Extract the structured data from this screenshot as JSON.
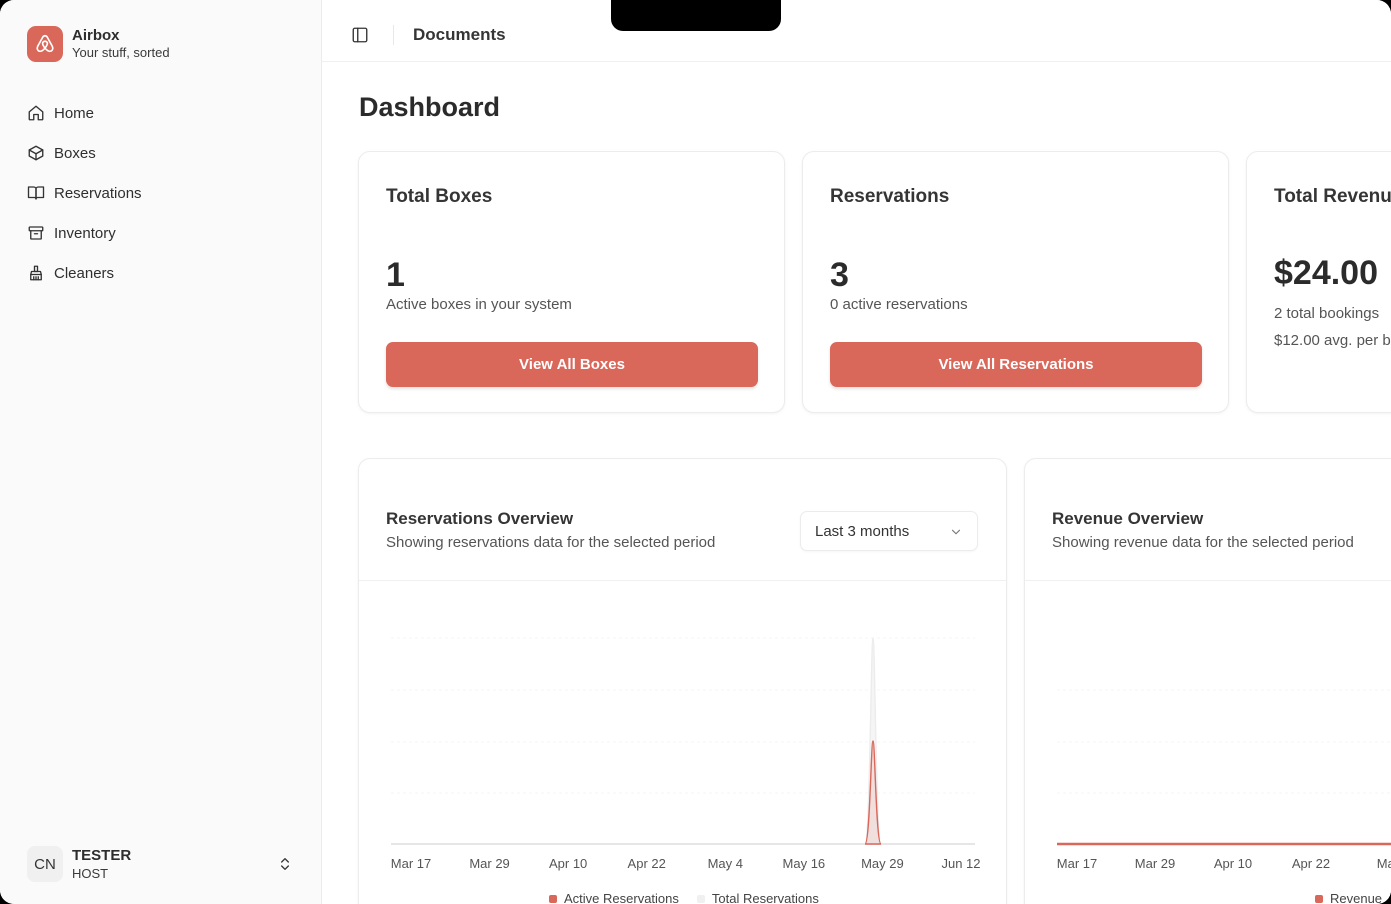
{
  "brand": {
    "name": "Airbox",
    "tagline": "Your stuff, sorted"
  },
  "sidebar": {
    "items": [
      {
        "label": "Home",
        "icon": "home-icon"
      },
      {
        "label": "Boxes",
        "icon": "box-icon"
      },
      {
        "label": "Reservations",
        "icon": "book-icon"
      },
      {
        "label": "Inventory",
        "icon": "archive-icon"
      },
      {
        "label": "Cleaners",
        "icon": "broom-icon"
      }
    ]
  },
  "user": {
    "initials": "CN",
    "name": "TESTER",
    "role": "HOST"
  },
  "header": {
    "title": "Documents"
  },
  "page": {
    "title": "Dashboard"
  },
  "cards": {
    "boxes": {
      "title": "Total Boxes",
      "value": "1",
      "subtitle": "Active boxes in your system",
      "button": "View All Boxes"
    },
    "reservations": {
      "title": "Reservations",
      "value": "3",
      "subtitle": "0 active reservations",
      "button": "View All Reservations"
    },
    "revenue": {
      "title": "Total Revenu",
      "value": "$24.00",
      "line1": "2 total bookings",
      "line2": "$12.00 avg. per b"
    }
  },
  "reservations_overview": {
    "title": "Reservations Overview",
    "subtitle": "Showing reservations data for the selected period",
    "range_select": "Last 3 months"
  },
  "revenue_overview": {
    "title": "Revenue Overview",
    "subtitle": "Showing revenue data for the selected period"
  },
  "colors": {
    "accent": "#d9675a",
    "total_series": "#ececec"
  },
  "chart_data": [
    {
      "type": "area",
      "title": "Reservations Overview",
      "x": [
        "Mar 17",
        "Mar 29",
        "Apr 10",
        "Apr 22",
        "May 4",
        "May 16",
        "May 29",
        "Jun 12"
      ],
      "series": [
        {
          "name": "Active Reservations",
          "color": "#d9675a",
          "spike_date": "May 28",
          "spike_value": 1
        },
        {
          "name": "Total Reservations",
          "color": "#e6e6e6",
          "spike_date": "May 28",
          "spike_value": 2
        }
      ],
      "baseline": 0,
      "grid": true,
      "legend": "bottom"
    },
    {
      "type": "line",
      "title": "Revenue Overview",
      "x": [
        "Mar 17",
        "Mar 29",
        "Apr 10",
        "Apr 22",
        "May"
      ],
      "series": [
        {
          "name": "Revenue",
          "color": "#d9675a",
          "values": [
            0,
            0,
            0,
            0,
            0
          ]
        }
      ],
      "grid": true,
      "legend": "bottom"
    }
  ]
}
